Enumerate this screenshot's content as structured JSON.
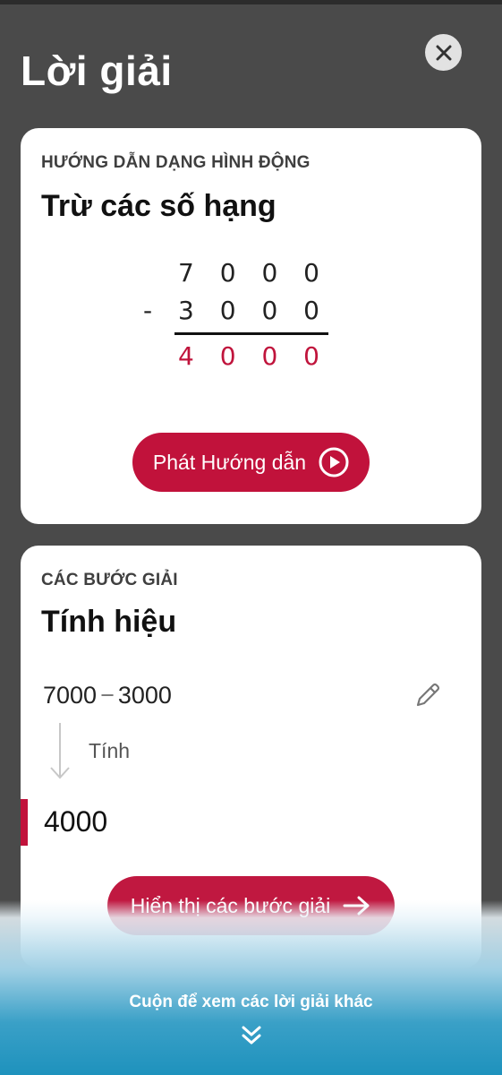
{
  "header": {
    "title": "Lời giải",
    "close_icon": "close-icon"
  },
  "animated_guide": {
    "kicker": "HƯỚNG DẪN DẠNG HÌNH ĐỘNG",
    "heading": "Trừ các số hạng",
    "operation": {
      "minuend": "7 0 0 0",
      "subtrahend": "- 3 0 0 0",
      "result": "4 0 0 0"
    },
    "play_button_label": "Phát Hướng dẫn",
    "play_icon": "play-circle-icon"
  },
  "solution_steps": {
    "kicker": "CÁC BƯỚC GIẢI",
    "heading": "Tính hiệu",
    "expression": {
      "left": "7000",
      "operator": "−",
      "right": "3000"
    },
    "edit_icon": "pencil-icon",
    "step_label": "Tính",
    "result": "4000",
    "show_steps_label": "Hiển thị các bước giải",
    "arrow_icon": "arrow-right-icon"
  },
  "footer": {
    "scroll_hint": "Cuộn để xem các lời giải khác",
    "scroll_icon": "double-chevron-down-icon"
  },
  "colors": {
    "accent": "#c1123b",
    "background": "#4a4a4a",
    "card": "#ffffff",
    "footer_gradient_end": "#1e92bd"
  }
}
